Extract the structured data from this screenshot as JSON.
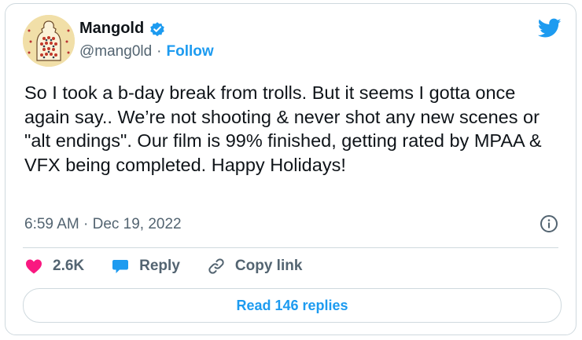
{
  "author": {
    "name": "Mangold",
    "handle": "@mang0ld",
    "separator": "·",
    "follow_label": "Follow"
  },
  "tweet": {
    "text": "So I took a b-day break from trolls. But it seems I gotta once again say.. We’re not shooting & never shot any new scenes or \"alt endings\". Our film is 99% finished, getting rated by MPAA & VFX being completed. Happy Holidays!",
    "timestamp": "6:59 AM · Dec 19, 2022"
  },
  "actions": {
    "likes": "2.6K",
    "reply_label": "Reply",
    "copy_link_label": "Copy link"
  },
  "read_replies_label": "Read 146 replies",
  "colors": {
    "accent": "#1d9bf0",
    "like": "#f91880",
    "text": "#0f1419",
    "muted": "#536471",
    "border": "#cfd9de"
  },
  "icons": [
    "verified-badge-icon",
    "twitter-bird-icon",
    "info-icon",
    "heart-icon",
    "reply-bubble-icon",
    "link-icon"
  ]
}
